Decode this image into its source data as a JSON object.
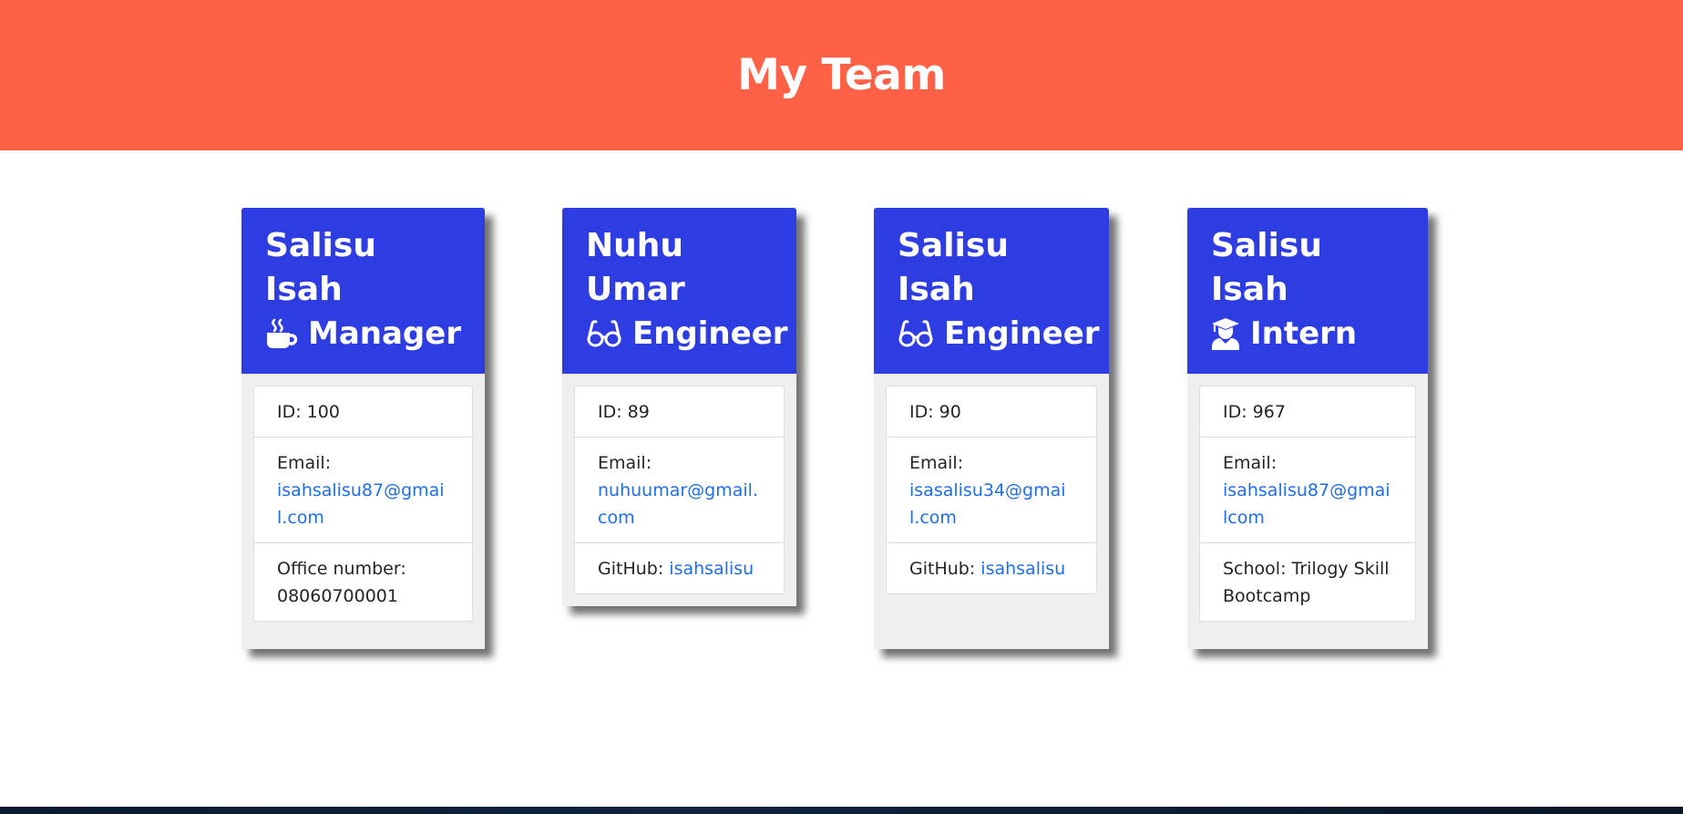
{
  "header": {
    "title": "My Team"
  },
  "cards": [
    {
      "name": "Salisu Isah",
      "role": "Manager",
      "role_icon": "coffee-mug-icon",
      "id_text": "ID: 100",
      "email_label": "Email:",
      "email": "isahsalisu87@gmail.com",
      "extra_label": "Office number:",
      "extra_value": "08060700001"
    },
    {
      "name": "Nuhu Umar",
      "role": "Engineer",
      "role_icon": "glasses-icon",
      "id_text": "ID: 89",
      "email_label": "Email:",
      "email": "nuhuumar@gmail.com",
      "extra_label": "GitHub:",
      "extra_value": "isahsalisu"
    },
    {
      "name": "Salisu Isah",
      "role": "Engineer",
      "role_icon": "glasses-icon",
      "id_text": "ID: 90",
      "email_label": "Email:",
      "email": "isasalisu34@gmail.com",
      "extra_label": "GitHub:",
      "extra_value": "isahsalisu"
    },
    {
      "name": "Salisu Isah",
      "role": "Intern",
      "role_icon": "graduate-icon",
      "id_text": "ID: 967",
      "email_label": "Email:",
      "email": "isahsalisu87@gmailcom",
      "extra_label": "School:",
      "extra_value": "Trilogy Skill Bootcamp"
    }
  ],
  "colors": {
    "header_bg": "#ff6147",
    "card_header_bg": "#2d3de2",
    "link": "#1e6fe6"
  }
}
